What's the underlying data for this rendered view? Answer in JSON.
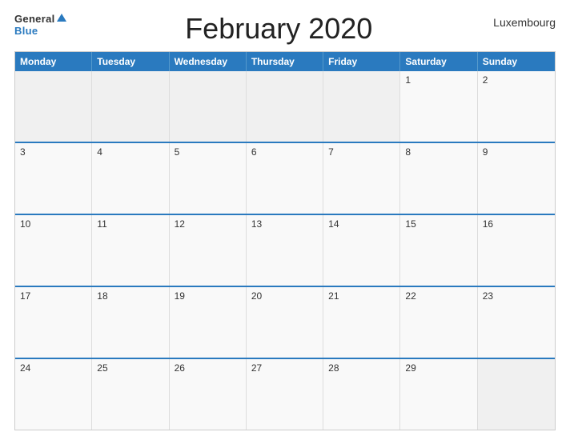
{
  "header": {
    "logo_general": "General",
    "logo_blue": "Blue",
    "title": "February 2020",
    "country": "Luxembourg"
  },
  "calendar": {
    "days": [
      "Monday",
      "Tuesday",
      "Wednesday",
      "Thursday",
      "Friday",
      "Saturday",
      "Sunday"
    ],
    "weeks": [
      [
        {
          "number": "",
          "empty": true
        },
        {
          "number": "",
          "empty": true
        },
        {
          "number": "",
          "empty": true
        },
        {
          "number": "",
          "empty": true
        },
        {
          "number": "",
          "empty": true
        },
        {
          "number": "1",
          "empty": false
        },
        {
          "number": "2",
          "empty": false
        }
      ],
      [
        {
          "number": "3",
          "empty": false
        },
        {
          "number": "4",
          "empty": false
        },
        {
          "number": "5",
          "empty": false
        },
        {
          "number": "6",
          "empty": false
        },
        {
          "number": "7",
          "empty": false
        },
        {
          "number": "8",
          "empty": false
        },
        {
          "number": "9",
          "empty": false
        }
      ],
      [
        {
          "number": "10",
          "empty": false
        },
        {
          "number": "11",
          "empty": false
        },
        {
          "number": "12",
          "empty": false
        },
        {
          "number": "13",
          "empty": false
        },
        {
          "number": "14",
          "empty": false
        },
        {
          "number": "15",
          "empty": false
        },
        {
          "number": "16",
          "empty": false
        }
      ],
      [
        {
          "number": "17",
          "empty": false
        },
        {
          "number": "18",
          "empty": false
        },
        {
          "number": "19",
          "empty": false
        },
        {
          "number": "20",
          "empty": false
        },
        {
          "number": "21",
          "empty": false
        },
        {
          "number": "22",
          "empty": false
        },
        {
          "number": "23",
          "empty": false
        }
      ],
      [
        {
          "number": "24",
          "empty": false
        },
        {
          "number": "25",
          "empty": false
        },
        {
          "number": "26",
          "empty": false
        },
        {
          "number": "27",
          "empty": false
        },
        {
          "number": "28",
          "empty": false
        },
        {
          "number": "29",
          "empty": false
        },
        {
          "number": "",
          "empty": true
        }
      ]
    ]
  }
}
